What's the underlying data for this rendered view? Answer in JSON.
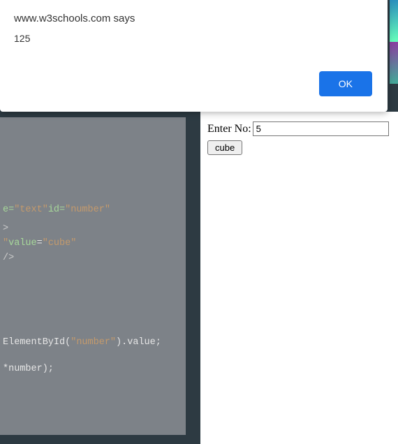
{
  "alert": {
    "origin": "www.w3schools.com says",
    "message": "125",
    "ok_label": "OK"
  },
  "editor": {
    "lines": {
      "l1_pre": "e=",
      "l1_str1": "\"text\"",
      "l1_mid": " id=",
      "l1_str2": "\"number\"",
      "l2": ">",
      "l3_pre": "\" ",
      "l3_attr": "value",
      "l3_eq": "=",
      "l3_str": "\"cube\"",
      "l4": "/>",
      "l5_method": "ElementById(",
      "l5_str": "\"number\"",
      "l5_tail": ").value;",
      "l6": "*number);"
    }
  },
  "result": {
    "label": "Enter No:",
    "input_value": "5",
    "button_label": "cube"
  }
}
